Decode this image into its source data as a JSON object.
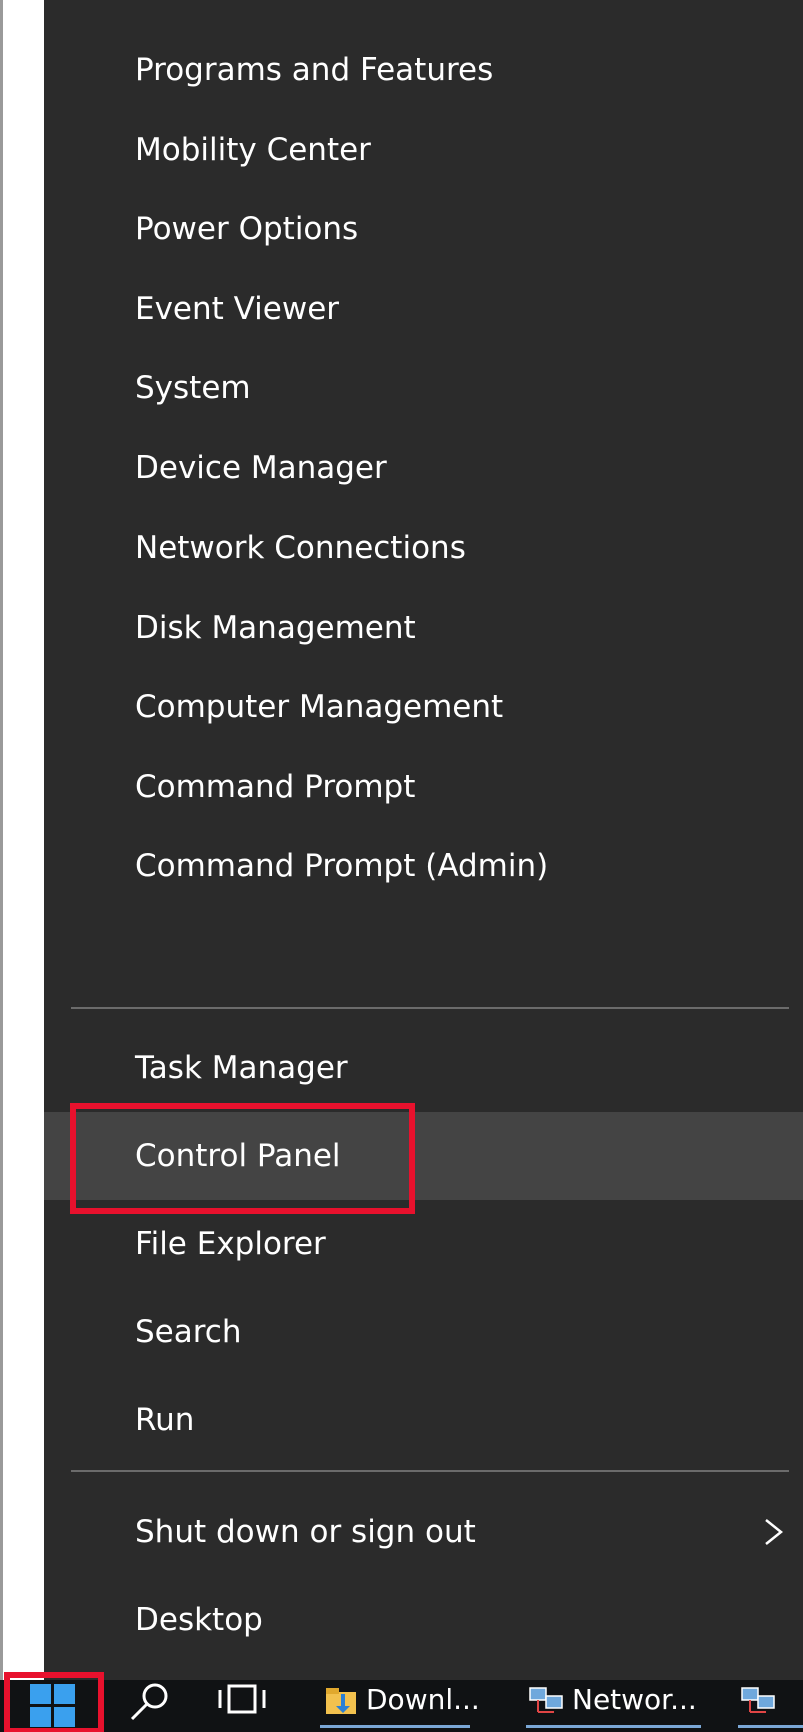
{
  "context_menu": {
    "groups": [
      {
        "items": [
          {
            "label": "Programs and Features"
          },
          {
            "label": "Mobility Center"
          },
          {
            "label": "Power Options"
          },
          {
            "label": "Event Viewer"
          },
          {
            "label": "System"
          },
          {
            "label": "Device Manager"
          },
          {
            "label": "Network Connections"
          },
          {
            "label": "Disk Management"
          },
          {
            "label": "Computer Management"
          },
          {
            "label": "Command Prompt"
          },
          {
            "label": "Command Prompt (Admin)"
          }
        ]
      },
      {
        "items": [
          {
            "label": "Task Manager"
          },
          {
            "label": "Control Panel",
            "state": "hovered",
            "highlighted": true
          },
          {
            "label": "File Explorer"
          },
          {
            "label": "Search"
          },
          {
            "label": "Run"
          }
        ]
      },
      {
        "items": [
          {
            "label": "Shut down or sign out",
            "submenu_icon": "chevron-right-icon"
          },
          {
            "label": "Desktop"
          }
        ]
      }
    ]
  },
  "taskbar": {
    "start_button_icon": "windows-logo-icon",
    "start_highlighted": true,
    "search_icon": "search-icon",
    "task_view_icon": "task-view-icon",
    "apps": [
      {
        "label": "Downl...",
        "icon": "folder-download-icon"
      },
      {
        "label": "Networ...",
        "icon": "network-icon"
      },
      {
        "label": "",
        "icon": "network-icon"
      }
    ]
  },
  "colors": {
    "menu_background": "#2b2b2b",
    "menu_hover": "#444444",
    "menu_text": "#ffffff",
    "separator": "#6b6b6b",
    "highlight_annotation": "#e8112d",
    "taskbar_background": "#101214",
    "windows_blue": "#3aa0ee"
  }
}
